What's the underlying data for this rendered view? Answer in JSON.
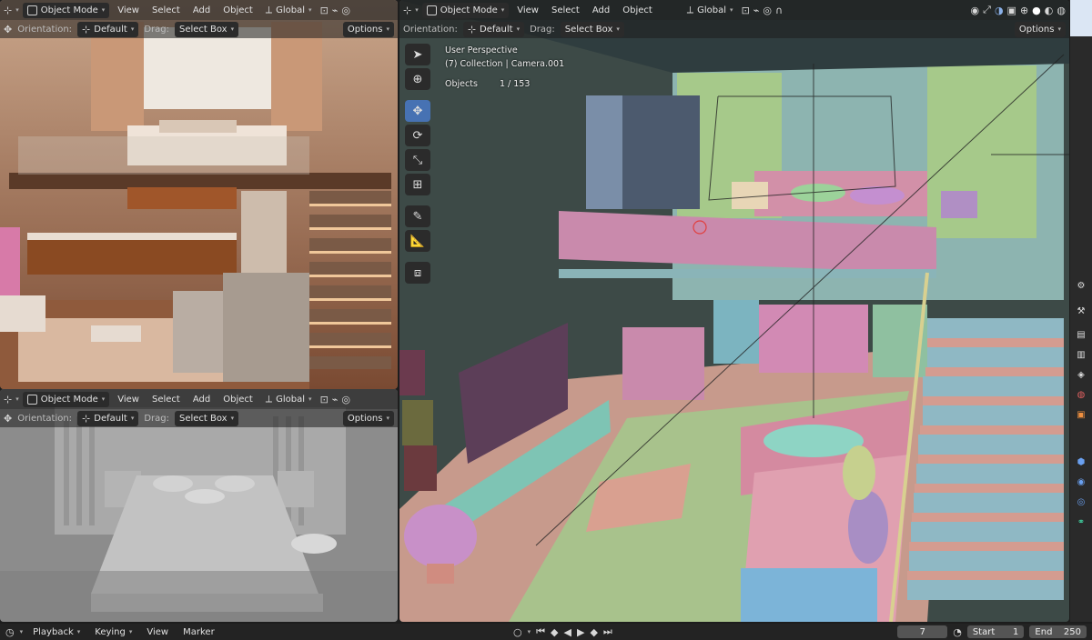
{
  "header": {
    "mode": "Object Mode",
    "menu_view": "View",
    "menu_select": "Select",
    "menu_add": "Add",
    "menu_object": "Object",
    "transform": "Global"
  },
  "tool_settings": {
    "orientation_label": "Orientation:",
    "orientation_value": "Default",
    "drag_label": "Drag:",
    "drag_value": "Select Box",
    "options": "Options"
  },
  "viewport_info": {
    "perspective": "User Perspective",
    "collection": "(7) Collection | Camera.001",
    "objects_label": "Objects",
    "objects_value": "1 / 153"
  },
  "timeline": {
    "playback": "Playback",
    "keying": "Keying",
    "view": "View",
    "marker": "Marker",
    "current_frame": "7",
    "start_label": "Start",
    "start_value": "1",
    "end_label": "End",
    "end_value": "250"
  },
  "colors": {
    "accent": "#4772b3",
    "header_bg": "#1e1e1e"
  },
  "icons": {
    "editor_type": "viewport-editor-icon",
    "mode": "object-mode-icon",
    "transform": "transform-orientation-icon",
    "cursor": "cursor-tool-icon",
    "select": "select-box-tool-icon",
    "move": "move-tool-icon",
    "rotate": "rotate-tool-icon",
    "scale": "scale-tool-icon",
    "transform_tool": "transform-tool-icon",
    "annotate": "annotate-tool-icon",
    "measure": "measure-tool-icon",
    "add_cube": "add-cube-tool-icon"
  }
}
